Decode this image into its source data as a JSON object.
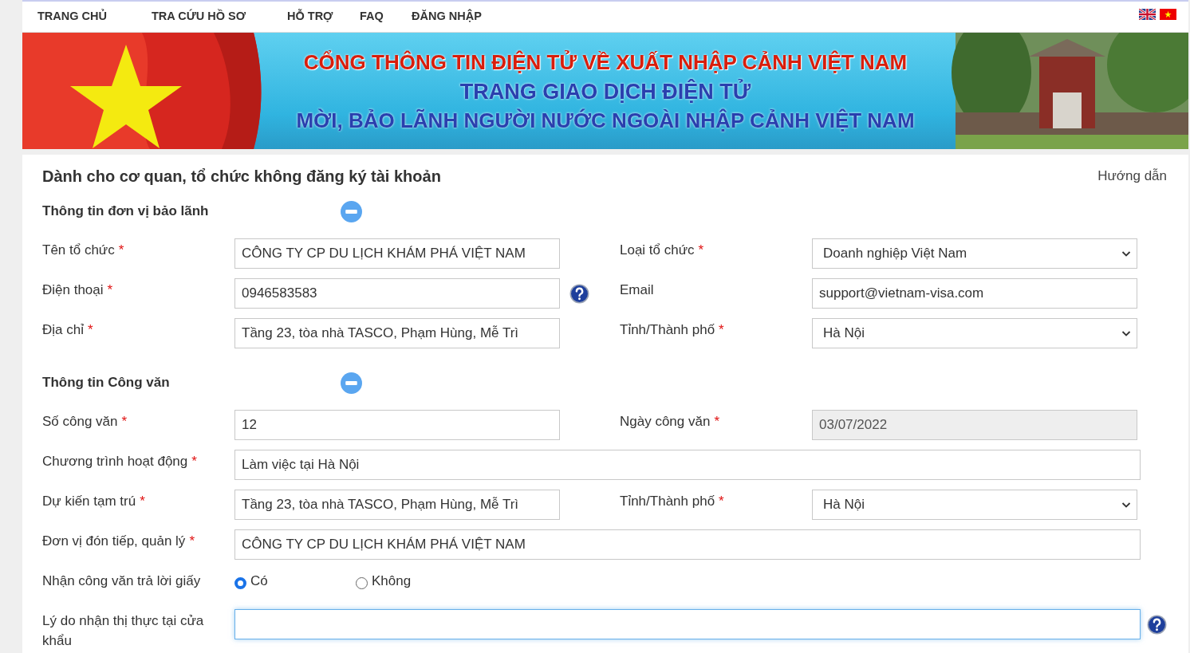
{
  "nav": {
    "items": [
      {
        "label": "TRANG CHỦ"
      },
      {
        "label": "TRA CỨU HỒ SƠ"
      },
      {
        "label": "HỖ TRỢ"
      },
      {
        "label": "FAQ"
      },
      {
        "label": "ĐĂNG NHẬP"
      }
    ],
    "languages": [
      {
        "kind": "english"
      },
      {
        "kind": "vietnamese"
      }
    ]
  },
  "banner": {
    "title": "CỔNG THÔNG TIN ĐIỆN TỬ VỀ XUẤT NHẬP CẢNH VIỆT NAM",
    "subtitle": "TRANG GIAO DỊCH ĐIỆN TỬ",
    "tagline": "MỜI, BẢO LÃNH NGƯỜI NƯỚC NGOÀI NHẬP CẢNH VIỆT NAM"
  },
  "page": {
    "title": "Dành cho cơ quan, tổ chức không đăng ký tài khoản",
    "help_link": "Hướng dẫn"
  },
  "sections": [
    {
      "title": "Thông tin đơn vị bảo lãnh",
      "expanded": true,
      "rows": [
        {
          "fields": [
            {
              "kind": "text",
              "label": "Tên tổ chức",
              "required_mark": "*",
              "value": "CÔNG TY CP DU LỊCH KHÁM PHÁ VIỆT NAM"
            },
            {
              "kind": "select",
              "label": "Loại tổ chức",
              "required_mark": "*",
              "value": "Doanh nghiệp Việt Nam"
            }
          ]
        },
        {
          "fields": [
            {
              "kind": "text",
              "label": "Điện thoại",
              "required_mark": "*",
              "value": "0946583583",
              "help": true
            },
            {
              "kind": "text",
              "label": "Email",
              "value": "support@vietnam-visa.com"
            }
          ]
        },
        {
          "fields": [
            {
              "kind": "text",
              "label": "Địa chỉ",
              "required_mark": "*",
              "value": "Tầng 23, tòa nhà TASCO, Phạm Hùng, Mễ Trì"
            },
            {
              "kind": "select",
              "label": "Tỉnh/Thành phố",
              "required_mark": "*",
              "value": "Hà Nội"
            }
          ]
        }
      ]
    },
    {
      "title": "Thông tin Công văn",
      "expanded": true,
      "rows": [
        {
          "fields": [
            {
              "kind": "text",
              "label": "Số công văn",
              "required_mark": "*",
              "value": "12"
            },
            {
              "kind": "text",
              "label": "Ngày công văn",
              "required_mark": "*",
              "value": "03/07/2022",
              "disabled": true
            }
          ]
        },
        {
          "fields": [
            {
              "kind": "text",
              "label": "Chương trình hoạt động",
              "required_mark": "*",
              "value": "Làm việc tại Hà Nội"
            }
          ]
        },
        {
          "fields": [
            {
              "kind": "text",
              "label": "Dự kiến tạm trú",
              "required_mark": "*",
              "value": "Tầng 23, tòa nhà TASCO, Phạm Hùng, Mễ Trì"
            },
            {
              "kind": "select",
              "label": "Tỉnh/Thành phố",
              "required_mark": "*",
              "value": "Hà Nội"
            }
          ]
        },
        {
          "fields": [
            {
              "kind": "text",
              "label": "Đơn vị đón tiếp, quản lý",
              "required_mark": "*",
              "value": "CÔNG TY CP DU LỊCH KHÁM PHÁ VIỆT NAM"
            }
          ]
        },
        {
          "fields": [
            {
              "kind": "radio",
              "label": "Nhận công văn trả lời giấy",
              "options": [
                {
                  "label": "Có",
                  "selected": true
                },
                {
                  "label": "Không",
                  "selected": false
                }
              ]
            }
          ]
        },
        {
          "fields": [
            {
              "kind": "text",
              "label": "Lý do nhận thị thực tại cửa khẩu",
              "focused": true,
              "help": true
            }
          ]
        }
      ]
    }
  ]
}
